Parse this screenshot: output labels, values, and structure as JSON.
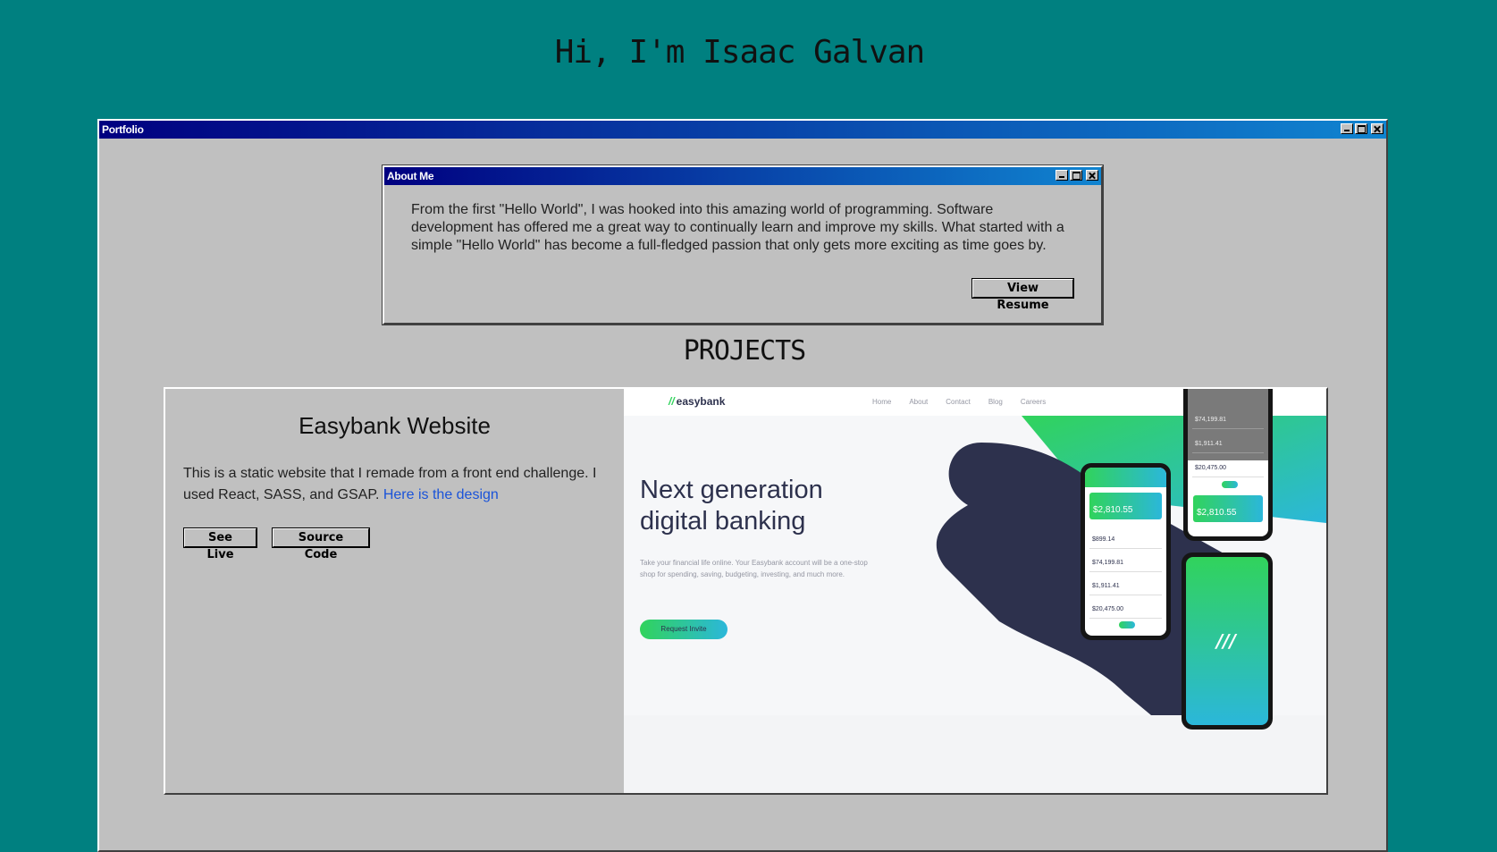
{
  "hero": {
    "title": "Hi, I'm Isaac Galvan"
  },
  "portfolio_window": {
    "title": "Portfolio"
  },
  "about_window": {
    "title": "About Me",
    "text": "From the first \"Hello World\", I was hooked into this amazing world of programming. Software development has offered me a great way to continually learn and improve my skills. What started with a simple \"Hello World\" has become a full-fledged passion that only gets more exciting as time goes by.",
    "resume_label": "View Resume"
  },
  "projects": {
    "heading": "PROJECTS",
    "items": [
      {
        "name": "Easybank Website",
        "description": "This is a static website that I remade from a front end challenge. I used React, SASS, and GSAP.",
        "link_text": "Here is the design",
        "live_label": "See Live",
        "source_label": "Source Code",
        "preview": {
          "logo": "easybank",
          "nav": [
            "Home",
            "About",
            "Contact",
            "Blog",
            "Careers"
          ],
          "cta": "Request Invite",
          "headline_1": "Next generation",
          "headline_2": "digital banking",
          "body": "Take your financial life online. Your Easybank account will be a one-stop shop for spending, saving, budgeting, investing, and much more.",
          "card_amount": "$2,810.55",
          "amounts": [
            "$899.14",
            "$74,199.81",
            "$1,911.41",
            "$20,475.00"
          ]
        }
      }
    ]
  },
  "colors": {
    "desktop": "#008080",
    "window": "#c0c0c0",
    "title_start": "#000080",
    "title_end": "#1084d0",
    "brand_green": "#31d35c",
    "brand_cyan": "#2bb7da",
    "brand_navy": "#2d314d"
  }
}
